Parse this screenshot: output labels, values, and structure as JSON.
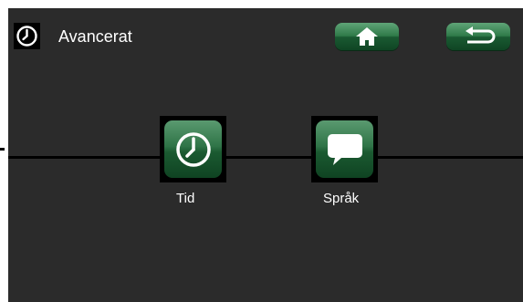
{
  "header": {
    "title": "Avancerat",
    "icon": "clock-icon"
  },
  "toolbar": {
    "home_icon": "home-icon",
    "back_icon": "back-arrow-icon"
  },
  "menu": {
    "items": [
      {
        "label": "Tid",
        "icon": "clock-icon"
      },
      {
        "label": "Språk",
        "icon": "speech-bubble-icon"
      }
    ]
  },
  "colors": {
    "accent_green": "#2f7a49",
    "background": "#2b2b2b"
  }
}
